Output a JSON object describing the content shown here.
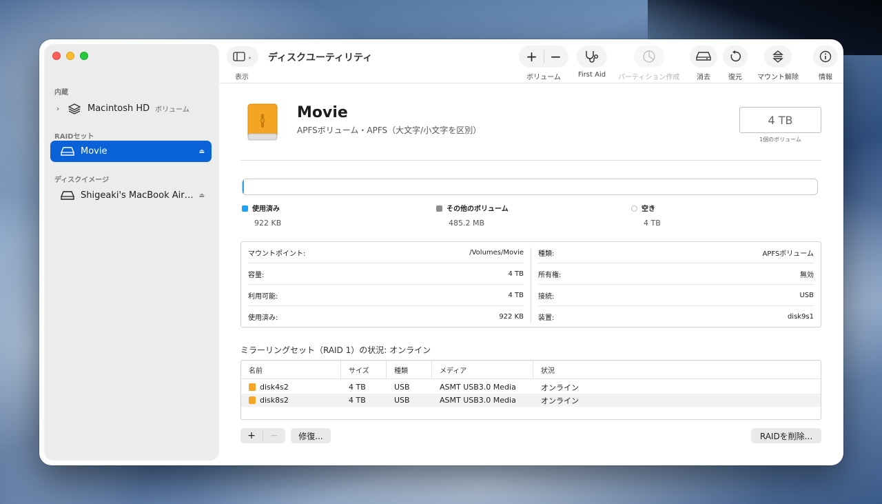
{
  "app": {
    "title": "ディスクユーティリティ",
    "view_label": "表示"
  },
  "toolbar": {
    "volume_label": "ボリューム",
    "first_aid_label": "First Aid",
    "partition_label": "パーティション作成",
    "erase_label": "消去",
    "restore_label": "復元",
    "unmount_label": "マウント解除",
    "info_label": "情報"
  },
  "sidebar": {
    "sections": [
      {
        "title": "内蔵",
        "items": [
          {
            "label": "Macintosh HD",
            "sublabel": "ボリューム",
            "icon": "layers-icon"
          }
        ]
      },
      {
        "title": "RAIDセット",
        "items": [
          {
            "label": "Movie",
            "icon": "drive-icon",
            "selected": true
          }
        ]
      },
      {
        "title": "ディスクイメージ",
        "items": [
          {
            "label": "Shigeaki's MacBook Air…",
            "icon": "drive-icon"
          }
        ]
      }
    ]
  },
  "volume": {
    "name": "Movie",
    "description": "APFSボリューム・APFS（大文字/小文字を区別）",
    "size": "4 TB",
    "size_caption": "1個のボリューム"
  },
  "usage": {
    "used": {
      "label": "使用済み",
      "value": "922 KB",
      "color": "#1da1f2",
      "fraction": 0.0
    },
    "other": {
      "label": "その他のボリューム",
      "value": "485.2 MB",
      "color": "#8c8c8c",
      "fraction": 0.0001
    },
    "free": {
      "label": "空き",
      "value": "4 TB",
      "color": "#ffffff"
    }
  },
  "info": {
    "left": [
      {
        "key": "マウントポイント:",
        "value": "/Volumes/Movie"
      },
      {
        "key": "容量:",
        "value": "4 TB"
      },
      {
        "key": "利用可能:",
        "value": "4 TB"
      },
      {
        "key": "使用済み:",
        "value": "922 KB"
      }
    ],
    "right": [
      {
        "key": "種類:",
        "value": "APFSボリューム"
      },
      {
        "key": "所有権:",
        "value": "無効"
      },
      {
        "key": "接続:",
        "value": "USB"
      },
      {
        "key": "装置:",
        "value": "disk9s1"
      }
    ]
  },
  "raid": {
    "title": "ミラーリングセット（RAID 1）の状況: オンライン",
    "columns": [
      "名前",
      "サイズ",
      "種類",
      "メディア",
      "状況"
    ],
    "rows": [
      {
        "name": "disk4s2",
        "size": "4 TB",
        "type": "USB",
        "media": "ASMT USB3.0 Media",
        "status": "オンライン"
      },
      {
        "name": "disk8s2",
        "size": "4 TB",
        "type": "USB",
        "media": "ASMT USB3.0 Media",
        "status": "オンライン"
      }
    ],
    "add_label": "+",
    "remove_label": "−",
    "repair_label": "修復...",
    "delete_label": "RAIDを削除..."
  }
}
